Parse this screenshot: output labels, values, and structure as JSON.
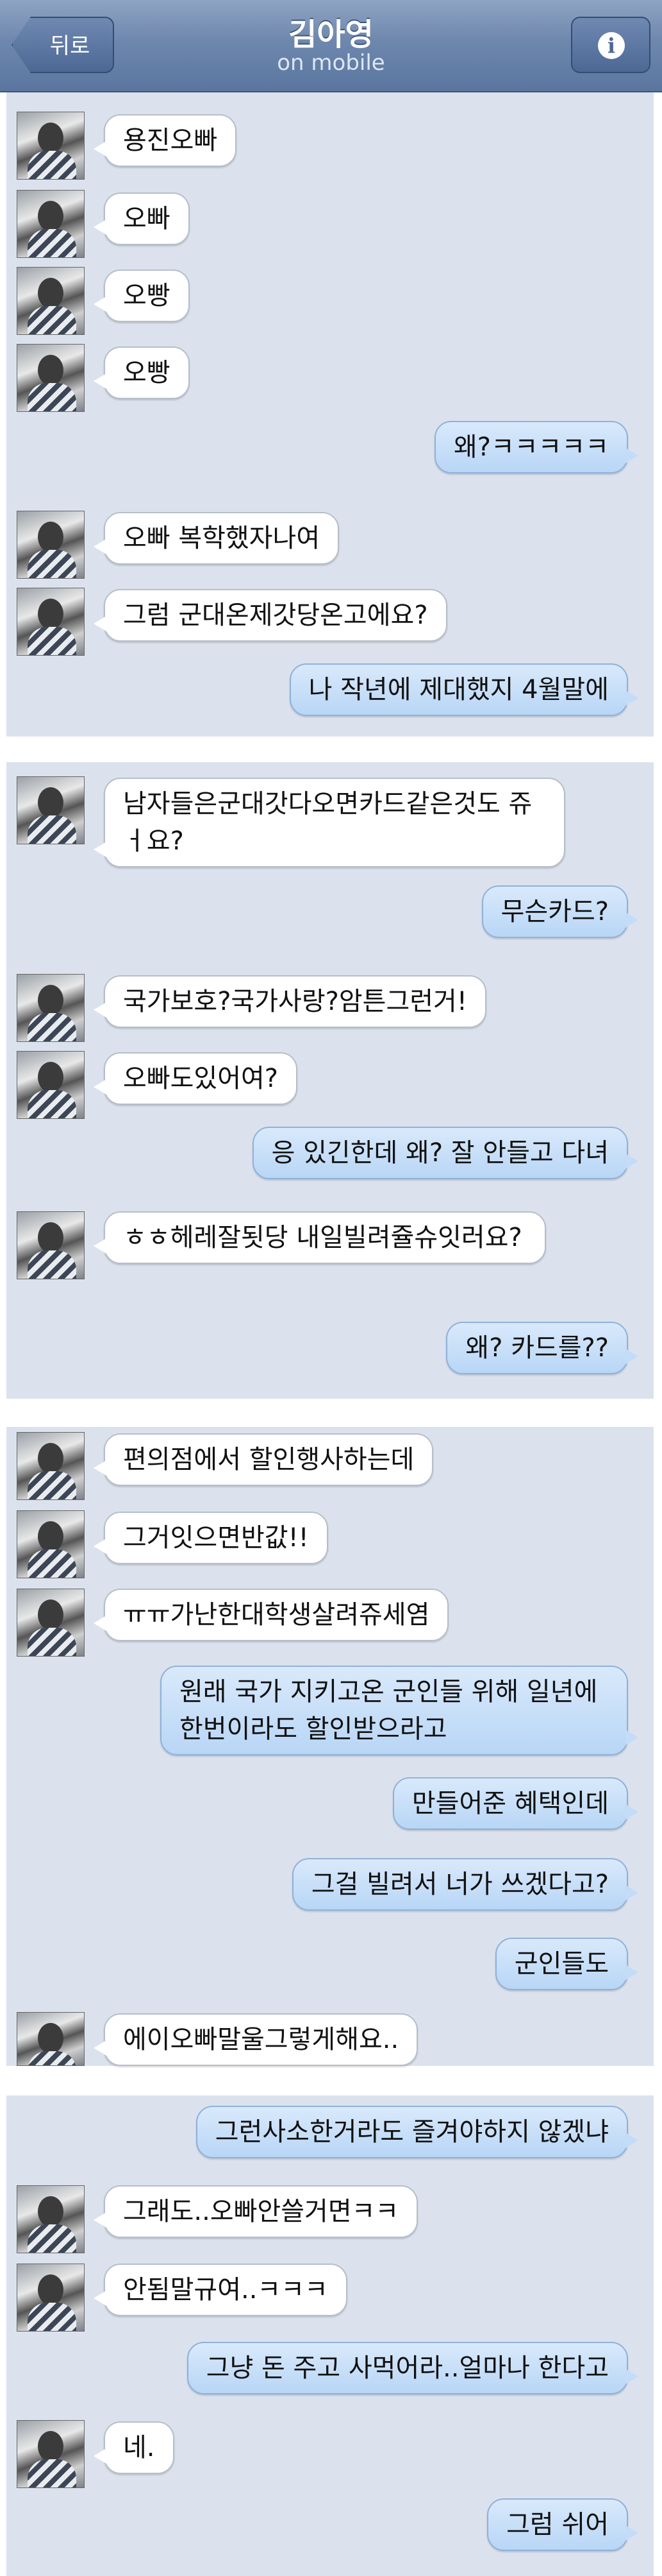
{
  "header": {
    "back_label": "뒤로",
    "contact_name": "김아영",
    "status": "on mobile",
    "info_icon": "i"
  },
  "panels": [
    {
      "messages": [
        {
          "side": "in",
          "text": "용진오빠"
        },
        {
          "side": "in",
          "text": "오빠"
        },
        {
          "side": "in",
          "text": "오빵"
        },
        {
          "side": "in",
          "text": "오빵"
        },
        {
          "side": "out",
          "text": "왜?ㅋㅋㅋㅋㅋ"
        },
        {
          "side": "in",
          "text": "오빠 복학했자나여"
        },
        {
          "side": "in",
          "text": "그럼 군대온제갓당온고에요?"
        },
        {
          "side": "out",
          "text": "나 작년에 제대했지 4월말에"
        }
      ]
    },
    {
      "messages": [
        {
          "side": "in",
          "text": "남자들은군대갓다오면카드같은것도 쥬ㅓ요?"
        },
        {
          "side": "out",
          "text": "무슨카드?"
        },
        {
          "side": "in",
          "text": "국가보호?국가사랑?암튼그런거!"
        },
        {
          "side": "in",
          "text": "오빠도있어여?"
        },
        {
          "side": "out",
          "text": "응 있긴한데 왜? 잘 안들고 다녀"
        },
        {
          "side": "in",
          "text": "ㅎㅎ헤레잘됫당 내일빌려쥴슈잇러요?"
        },
        {
          "side": "out",
          "text": "왜? 카드를??"
        }
      ]
    },
    {
      "messages": [
        {
          "side": "in",
          "text": "편의점에서 할인행사하는데"
        },
        {
          "side": "in",
          "text": "그거잇으면반값!!"
        },
        {
          "side": "in",
          "text": "ㅠㅠ가난한대학생살려쥬세염"
        },
        {
          "side": "out",
          "text": "원래 국가 지키고온 군인들 위해 일년에 한번이라도 할인받으라고"
        },
        {
          "side": "out",
          "text": "만들어준 혜택인데"
        },
        {
          "side": "out",
          "text": "그걸 빌려서 너가 쓰겠다고?"
        },
        {
          "side": "out",
          "text": "군인들도"
        },
        {
          "side": "in",
          "text": "에이오빠말울그렇게해요.."
        }
      ]
    },
    {
      "messages": [
        {
          "side": "out",
          "text": "그런사소한거라도 즐겨야하지 않겠냐"
        },
        {
          "side": "in",
          "text": "그래도..오빠안쓸거면ㅋㅋ"
        },
        {
          "side": "in",
          "text": "안됨말규여..ㅋㅋㅋ"
        },
        {
          "side": "out",
          "text": "그냥 돈 주고 사먹어라..얼마나 한다고"
        },
        {
          "side": "in",
          "text": "네."
        },
        {
          "side": "out",
          "text": "그럼 쉬어"
        }
      ]
    }
  ]
}
